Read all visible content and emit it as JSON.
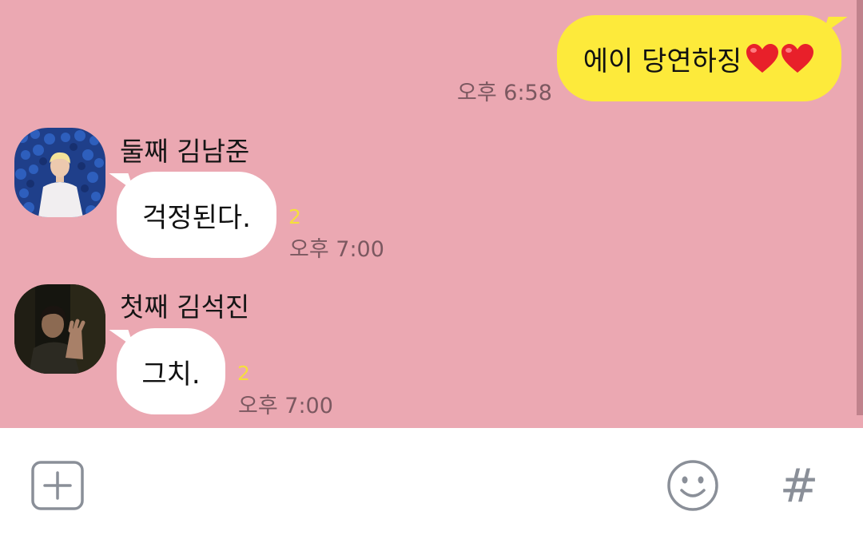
{
  "messages": {
    "outgoing": {
      "text": "에이 당연하징",
      "emoji": [
        "heart-emoji",
        "heart-emoji"
      ],
      "time": "오후 6:58"
    },
    "incoming": [
      {
        "sender": "둘째 김남준",
        "text": "걱정된다.",
        "unread": "2",
        "time": "오후 7:00"
      },
      {
        "sender": "첫째 김석진",
        "text": "그치.",
        "unread": "2",
        "time": "오후 7:00"
      }
    ]
  },
  "input_bar": {
    "attach_icon": "plus-square-icon",
    "emoji_icon": "smiley-icon",
    "hashtag_label": "#"
  },
  "colors": {
    "chat_background": "#eba8b2",
    "outgoing_bubble": "#fdea3b",
    "incoming_bubble": "#ffffff",
    "unread_count": "#f5df3c",
    "icon_gray": "#8a8f98"
  }
}
